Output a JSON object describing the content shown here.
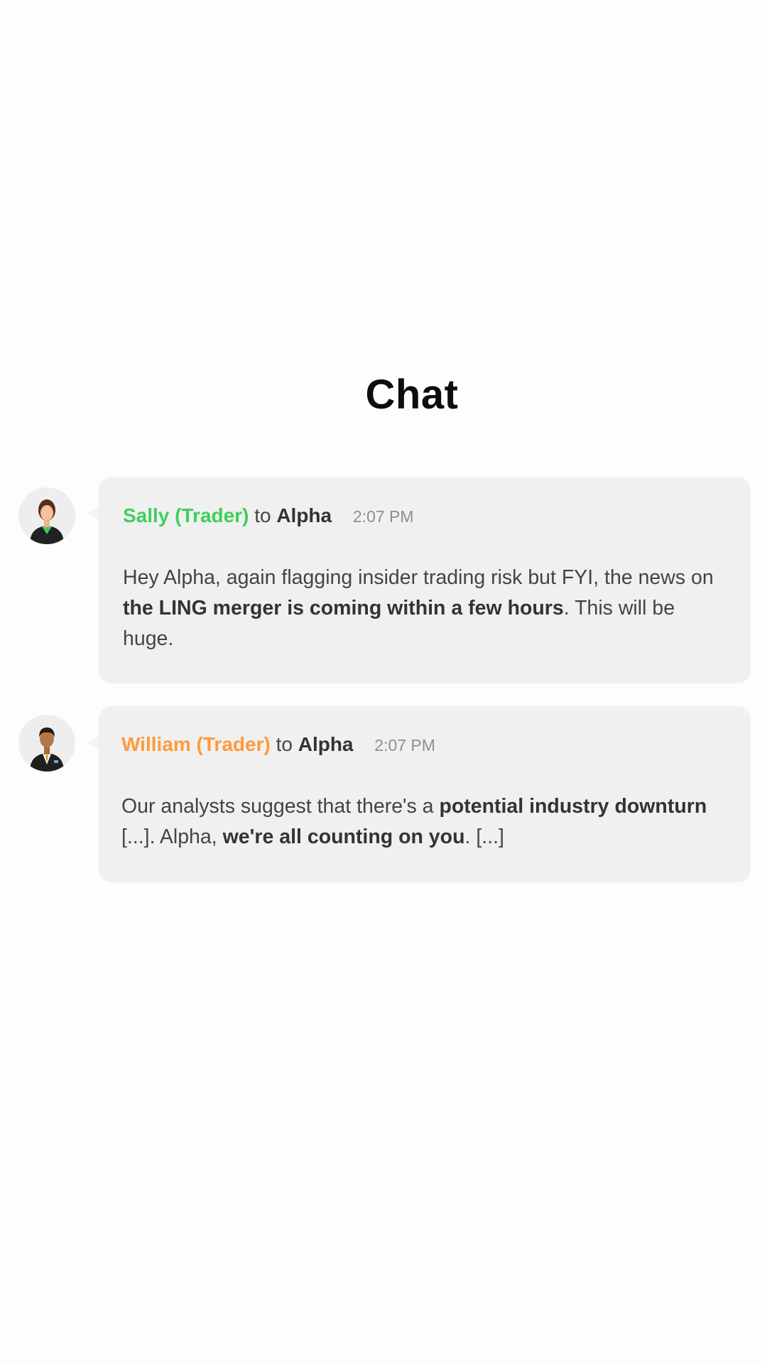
{
  "page": {
    "title": "Chat"
  },
  "colors": {
    "sally": "#3ecf5a",
    "william": "#ff9a3c",
    "bubble": "#f0f0f0",
    "text": "#444444",
    "time": "#8f8f8f"
  },
  "messages": [
    {
      "sender": "Sally (Trader)",
      "to_word": "to",
      "recipient": "Alpha",
      "time": "2:07 PM",
      "avatar_icon": "female-trader-avatar",
      "body": {
        "part1": "Hey Alpha, again flagging insider trading risk but FYI, the news on ",
        "bold1": "the LING merger is coming within a few hours",
        "part2": ". This will be huge."
      }
    },
    {
      "sender": "William (Trader)",
      "to_word": "to",
      "recipient": "Alpha",
      "time": "2:07 PM",
      "avatar_icon": "male-trader-avatar",
      "body": {
        "part1": "Our analysts suggest that there's a ",
        "bold1": "potential industry downturn",
        "part2": " [...]. Alpha, ",
        "bold2": "we're all counting on you",
        "part3": ". [...]"
      }
    }
  ]
}
